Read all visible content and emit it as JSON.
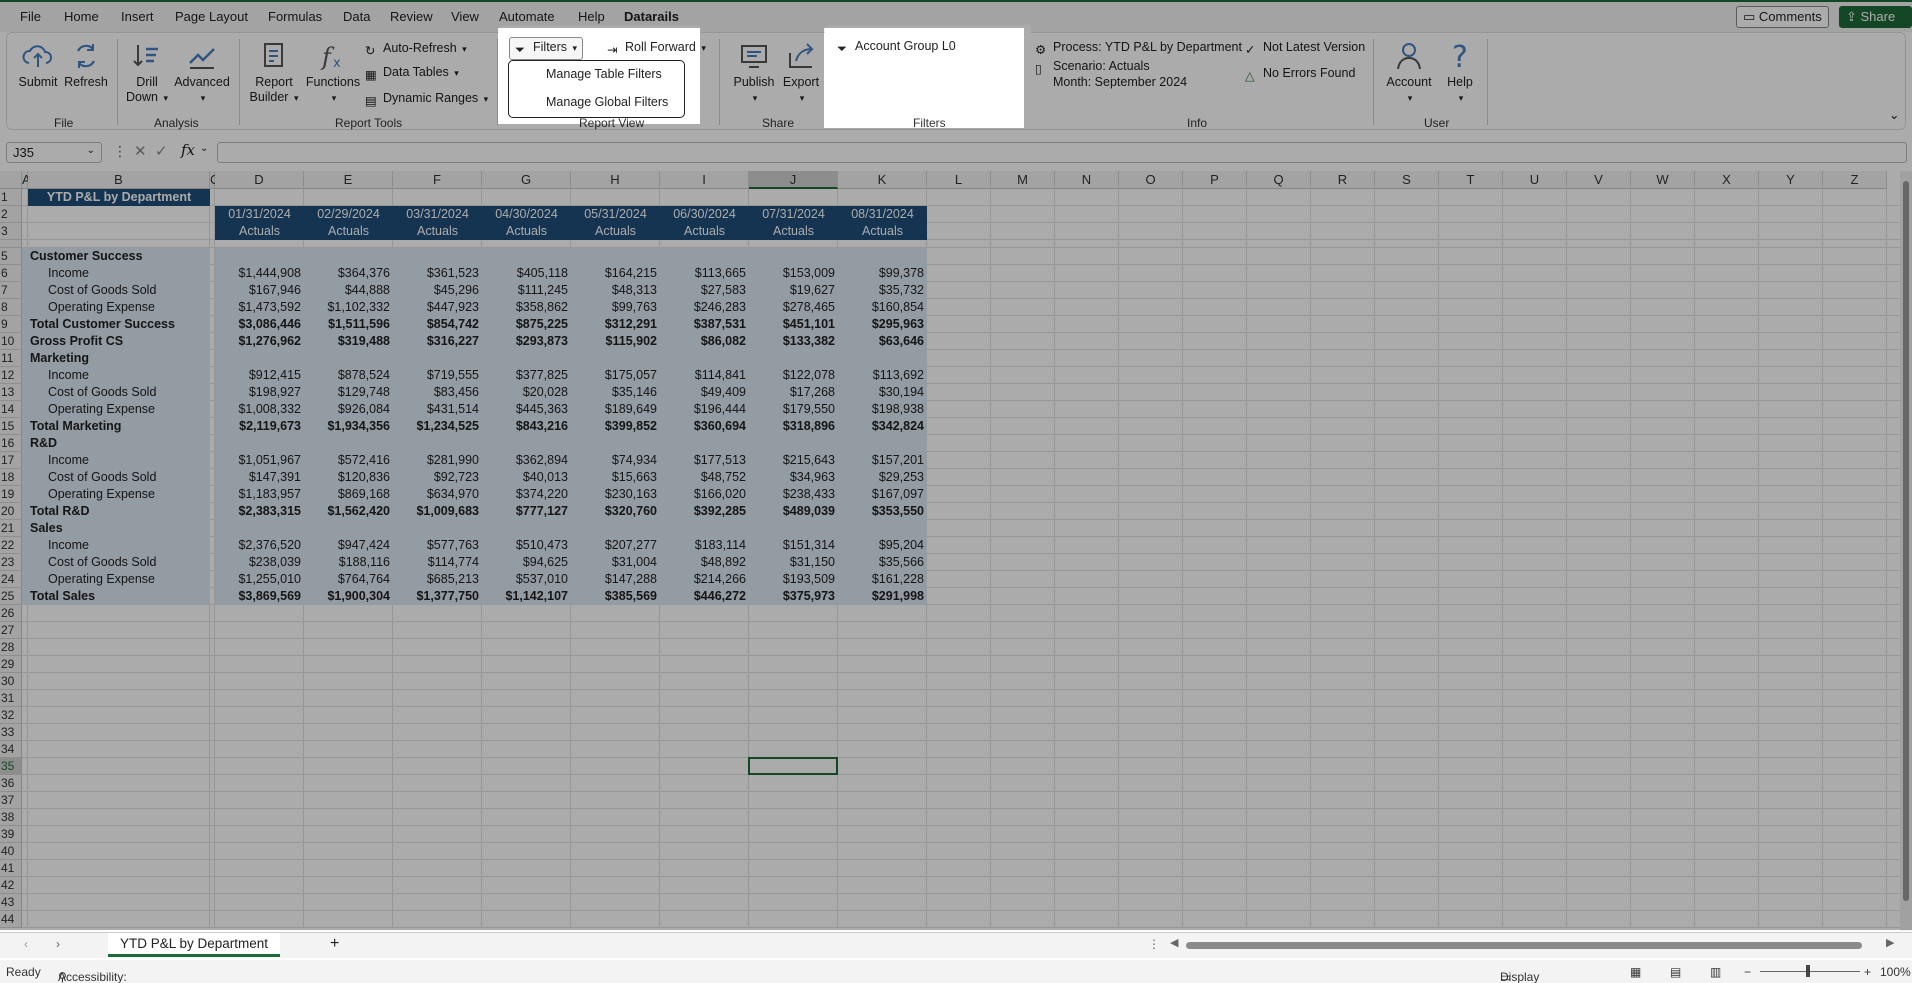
{
  "menu": {
    "tabs": [
      "File",
      "Home",
      "Insert",
      "Page Layout",
      "Formulas",
      "Data",
      "Review",
      "View",
      "Automate",
      "Help",
      "Datarails"
    ],
    "comments_label": "Comments",
    "share_label": "Share"
  },
  "ribbon": {
    "file_group": {
      "label": "File",
      "submit": "Submit",
      "refresh": "Refresh"
    },
    "analysis_group": {
      "label": "Analysis",
      "drill_down_1": "Drill",
      "drill_down_2": "Down",
      "advanced": "Advanced"
    },
    "report_tools_group": {
      "label": "Report Tools",
      "report_builder_1": "Report",
      "report_builder_2": "Builder",
      "functions": "Functions",
      "auto_refresh": "Auto-Refresh",
      "data_tables": "Data Tables",
      "dynamic_ranges": "Dynamic Ranges"
    },
    "report_view_group": {
      "label": "Report View",
      "filters": "Filters",
      "roll_forward": "Roll Forward"
    },
    "filters_menu": {
      "manage_table_filters": "Manage Table Filters",
      "manage_global_filters": "Manage Global Filters"
    },
    "share_group": {
      "label": "Share",
      "publish": "Publish",
      "export": "Export"
    },
    "filters_group": {
      "label": "Filters",
      "account_group": "Account Group L0"
    },
    "info_group": {
      "label": "Info",
      "process": "Process: YTD P&L by Department",
      "scenario": "Scenario: Actuals",
      "month": "Month: September 2024",
      "version": "Not Latest Version",
      "errors": "No Errors Found"
    },
    "user_group": {
      "label": "User",
      "account": "Account",
      "help": "Help"
    }
  },
  "formula_bar": {
    "name_box": "J35",
    "fx": "fx",
    "value": ""
  },
  "columns": [
    "A",
    "B",
    "C",
    "D",
    "E",
    "F",
    "G",
    "H",
    "I",
    "J",
    "K",
    "L",
    "M",
    "N",
    "O",
    "P",
    "Q",
    "R",
    "S",
    "T",
    "U",
    "V",
    "W",
    "X",
    "Y",
    "Z"
  ],
  "rows_count": 44,
  "sheet": {
    "title": "YTD P&L by Department",
    "dates": [
      "01/31/2024",
      "02/29/2024",
      "03/31/2024",
      "04/30/2024",
      "05/31/2024",
      "06/30/2024",
      "07/31/2024",
      "08/31/2024"
    ],
    "scenario_label": "Actuals",
    "data_rows": [
      {
        "row": 5,
        "label": "Customer Success",
        "style": "section",
        "values": []
      },
      {
        "row": 6,
        "label": "Income",
        "style": "item",
        "values": [
          "$1,444,908",
          "$364,376",
          "$361,523",
          "$405,118",
          "$164,215",
          "$113,665",
          "$153,009",
          "$99,378"
        ]
      },
      {
        "row": 7,
        "label": "Cost of Goods Sold",
        "style": "item",
        "values": [
          "$167,946",
          "$44,888",
          "$45,296",
          "$111,245",
          "$48,313",
          "$27,583",
          "$19,627",
          "$35,732"
        ]
      },
      {
        "row": 8,
        "label": "Operating Expense",
        "style": "item",
        "values": [
          "$1,473,592",
          "$1,102,332",
          "$447,923",
          "$358,862",
          "$99,763",
          "$246,283",
          "$278,465",
          "$160,854"
        ]
      },
      {
        "row": 9,
        "label": "Total Customer Success",
        "style": "total",
        "values": [
          "$3,086,446",
          "$1,511,596",
          "$854,742",
          "$875,225",
          "$312,291",
          "$387,531",
          "$451,101",
          "$295,963"
        ]
      },
      {
        "row": 10,
        "label": "Gross Profit CS",
        "style": "total",
        "values": [
          "$1,276,962",
          "$319,488",
          "$316,227",
          "$293,873",
          "$115,902",
          "$86,082",
          "$133,382",
          "$63,646"
        ]
      },
      {
        "row": 11,
        "label": "Marketing",
        "style": "section",
        "values": []
      },
      {
        "row": 12,
        "label": "Income",
        "style": "item",
        "values": [
          "$912,415",
          "$878,524",
          "$719,555",
          "$377,825",
          "$175,057",
          "$114,841",
          "$122,078",
          "$113,692"
        ]
      },
      {
        "row": 13,
        "label": "Cost of Goods Sold",
        "style": "item",
        "values": [
          "$198,927",
          "$129,748",
          "$83,456",
          "$20,028",
          "$35,146",
          "$49,409",
          "$17,268",
          "$30,194"
        ]
      },
      {
        "row": 14,
        "label": "Operating Expense",
        "style": "item",
        "values": [
          "$1,008,332",
          "$926,084",
          "$431,514",
          "$445,363",
          "$189,649",
          "$196,444",
          "$179,550",
          "$198,938"
        ]
      },
      {
        "row": 15,
        "label": "Total Marketing",
        "style": "total",
        "values": [
          "$2,119,673",
          "$1,934,356",
          "$1,234,525",
          "$843,216",
          "$399,852",
          "$360,694",
          "$318,896",
          "$342,824"
        ]
      },
      {
        "row": 16,
        "label": "R&D",
        "style": "section",
        "values": []
      },
      {
        "row": 17,
        "label": "Income",
        "style": "item",
        "values": [
          "$1,051,967",
          "$572,416",
          "$281,990",
          "$362,894",
          "$74,934",
          "$177,513",
          "$215,643",
          "$157,201"
        ]
      },
      {
        "row": 18,
        "label": "Cost of Goods Sold",
        "style": "item",
        "values": [
          "$147,391",
          "$120,836",
          "$92,723",
          "$40,013",
          "$15,663",
          "$48,752",
          "$34,963",
          "$29,253"
        ]
      },
      {
        "row": 19,
        "label": "Operating Expense",
        "style": "item",
        "values": [
          "$1,183,957",
          "$869,168",
          "$634,970",
          "$374,220",
          "$230,163",
          "$166,020",
          "$238,433",
          "$167,097"
        ]
      },
      {
        "row": 20,
        "label": "Total R&D",
        "style": "total",
        "values": [
          "$2,383,315",
          "$1,562,420",
          "$1,009,683",
          "$777,127",
          "$320,760",
          "$392,285",
          "$489,039",
          "$353,550"
        ]
      },
      {
        "row": 21,
        "label": "Sales",
        "style": "section",
        "values": []
      },
      {
        "row": 22,
        "label": "Income",
        "style": "item",
        "values": [
          "$2,376,520",
          "$947,424",
          "$577,763",
          "$510,473",
          "$207,277",
          "$183,114",
          "$151,314",
          "$95,204"
        ]
      },
      {
        "row": 23,
        "label": "Cost of Goods Sold",
        "style": "item",
        "values": [
          "$238,039",
          "$188,116",
          "$114,774",
          "$94,625",
          "$31,004",
          "$48,892",
          "$31,150",
          "$35,566"
        ]
      },
      {
        "row": 24,
        "label": "Operating Expense",
        "style": "item",
        "values": [
          "$1,255,010",
          "$764,764",
          "$685,213",
          "$537,010",
          "$147,288",
          "$214,266",
          "$193,509",
          "$161,228"
        ]
      },
      {
        "row": 25,
        "label": "Total Sales",
        "style": "total",
        "values": [
          "$3,869,569",
          "$1,900,304",
          "$1,377,750",
          "$1,142,107",
          "$385,569",
          "$446,272",
          "$375,973",
          "$291,998"
        ]
      }
    ]
  },
  "sheet_tab": "YTD P&L by Department",
  "add_sheet": "+",
  "status": {
    "ready": "Ready",
    "accessibility": "Accessibility: Good to go",
    "display_settings": "Display Settings",
    "zoom": "100%"
  },
  "colors": {
    "accent": "#1e6b3a",
    "header_band": "#1f4e79",
    "table_fill": "#dbe7f3"
  }
}
